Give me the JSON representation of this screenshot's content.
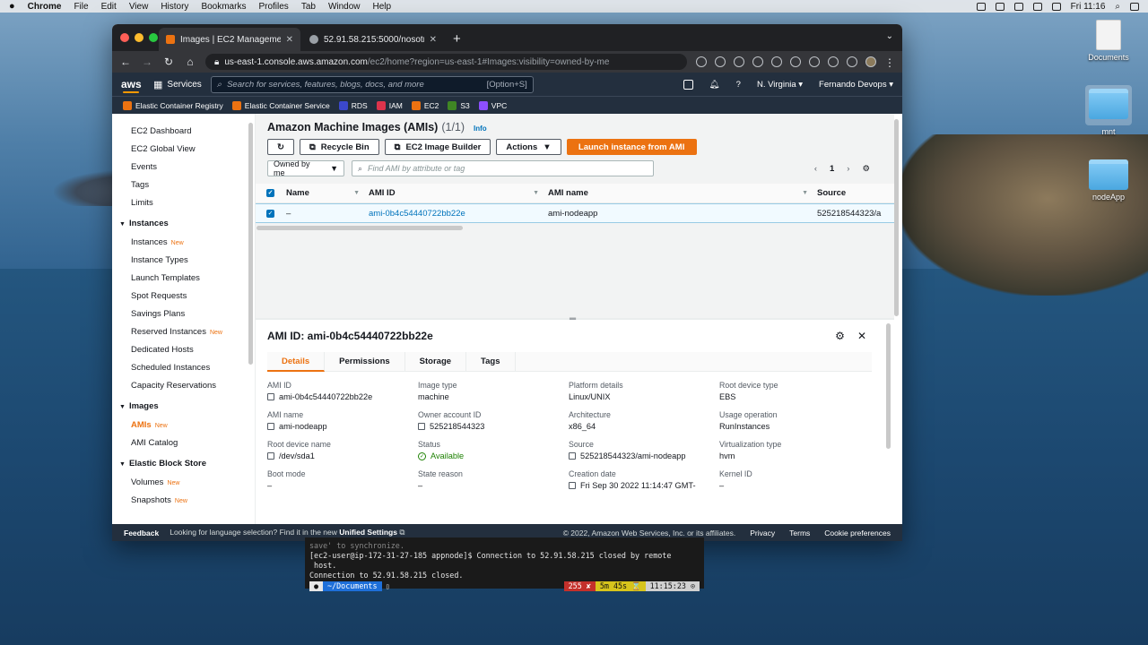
{
  "menubar": {
    "app": "Chrome",
    "items": [
      "File",
      "Edit",
      "View",
      "History",
      "Bookmarks",
      "Profiles",
      "Tab",
      "Window",
      "Help"
    ],
    "clock": "Fri 11:16"
  },
  "desktop": {
    "icons": [
      "Documents",
      "mnt",
      "nodeApp"
    ]
  },
  "browser": {
    "tabs": [
      {
        "title": "Images | EC2 Management Co"
      },
      {
        "title": "52.91.58.215:5000/nosotros"
      }
    ],
    "url_host": "us-east-1.console.aws.amazon.com",
    "url_path": "/ec2/home?region=us-east-1#Images:visibility=owned-by-me"
  },
  "awsnav": {
    "logo": "aws",
    "services": "Services",
    "search_placeholder": "Search for services, features, blogs, docs, and more",
    "search_kbd": "[Option+S]",
    "region": "N. Virginia",
    "account": "Fernando Devops"
  },
  "favorites": [
    {
      "label": "Elastic Container Registry",
      "color": "#ec7211"
    },
    {
      "label": "Elastic Container Service",
      "color": "#ec7211"
    },
    {
      "label": "RDS",
      "color": "#3b48cc"
    },
    {
      "label": "IAM",
      "color": "#dd344c"
    },
    {
      "label": "EC2",
      "color": "#ec7211"
    },
    {
      "label": "S3",
      "color": "#3f8624"
    },
    {
      "label": "VPC",
      "color": "#8c4fff"
    }
  ],
  "sidebar": {
    "top_links": [
      "EC2 Dashboard",
      "EC2 Global View",
      "Events",
      "Tags",
      "Limits"
    ],
    "new_badge": "New",
    "sections": [
      {
        "title": "Instances",
        "items": [
          {
            "label": "Instances",
            "new": true
          },
          {
            "label": "Instance Types",
            "new": false
          },
          {
            "label": "Launch Templates",
            "new": false
          },
          {
            "label": "Spot Requests",
            "new": false
          },
          {
            "label": "Savings Plans",
            "new": false
          },
          {
            "label": "Reserved Instances",
            "new": true
          },
          {
            "label": "Dedicated Hosts",
            "new": false
          },
          {
            "label": "Scheduled Instances",
            "new": false
          },
          {
            "label": "Capacity Reservations",
            "new": false
          }
        ]
      },
      {
        "title": "Images",
        "items": [
          {
            "label": "AMIs",
            "new": true,
            "active": true
          },
          {
            "label": "AMI Catalog",
            "new": false
          }
        ]
      },
      {
        "title": "Elastic Block Store",
        "items": [
          {
            "label": "Volumes",
            "new": true
          },
          {
            "label": "Snapshots",
            "new": true
          }
        ]
      }
    ]
  },
  "amis": {
    "title": "Amazon Machine Images (AMIs)",
    "count": "(1/1)",
    "info": "Info",
    "buttons": {
      "recycle_bin": "Recycle Bin",
      "image_builder": "EC2 Image Builder",
      "actions": "Actions",
      "launch": "Launch instance from AMI"
    },
    "filter_select": "Owned by me",
    "filter_placeholder": "Find AMI by attribute or tag",
    "page": "1",
    "columns": [
      "Name",
      "AMI ID",
      "AMI name",
      "Source"
    ],
    "rows": [
      {
        "name": "–",
        "ami_id": "ami-0b4c54440722bb22e",
        "ami_name": "ami-nodeapp",
        "source": "525218544323/a"
      }
    ]
  },
  "details": {
    "title": "AMI ID: ami-0b4c54440722bb22e",
    "tabs": [
      "Details",
      "Permissions",
      "Storage",
      "Tags"
    ],
    "fields": [
      {
        "label": "AMI ID",
        "value": "ami-0b4c54440722bb22e",
        "icon": "copy"
      },
      {
        "label": "Image type",
        "value": "machine",
        "icon": ""
      },
      {
        "label": "Platform details",
        "value": "Linux/UNIX",
        "icon": ""
      },
      {
        "label": "Root device type",
        "value": "EBS",
        "icon": ""
      },
      {
        "label": "AMI name",
        "value": "ami-nodeapp",
        "icon": "copy"
      },
      {
        "label": "Owner account ID",
        "value": "525218544323",
        "icon": "copy"
      },
      {
        "label": "Architecture",
        "value": "x86_64",
        "icon": ""
      },
      {
        "label": "Usage operation",
        "value": "RunInstances",
        "icon": ""
      },
      {
        "label": "Root device name",
        "value": "/dev/sda1",
        "icon": "copy"
      },
      {
        "label": "Status",
        "value": "Available",
        "icon": "ok"
      },
      {
        "label": "Source",
        "value": "525218544323/ami-nodeapp",
        "icon": "copy"
      },
      {
        "label": "Virtualization type",
        "value": "hvm",
        "icon": ""
      },
      {
        "label": "Boot mode",
        "value": "–",
        "icon": ""
      },
      {
        "label": "State reason",
        "value": "–",
        "icon": ""
      },
      {
        "label": "Creation date",
        "value": "Fri Sep 30 2022 11:14:47 GMT-",
        "icon": "copy"
      },
      {
        "label": "Kernel ID",
        "value": "–",
        "icon": ""
      }
    ]
  },
  "footer": {
    "feedback": "Feedback",
    "language": "Looking for language selection? Find it in the new",
    "unified": "Unified Settings",
    "copyright": "© 2022, Amazon Web Services, Inc. or its affiliates.",
    "privacy": "Privacy",
    "terms": "Terms",
    "cookies": "Cookie preferences"
  },
  "terminal": {
    "lines": [
      "save' to synchronize.",
      "[ec2-user@ip-172-31-27-185 appnode]$ Connection to 52.91.58.215 closed by remote",
      " host.",
      "Connection to 52.91.58.215 closed."
    ],
    "prompt_dir": "~/Documents",
    "exit_code": "255 ✘",
    "duration": "5m 45s ⌛",
    "time": "11:15:23 ⊙"
  }
}
